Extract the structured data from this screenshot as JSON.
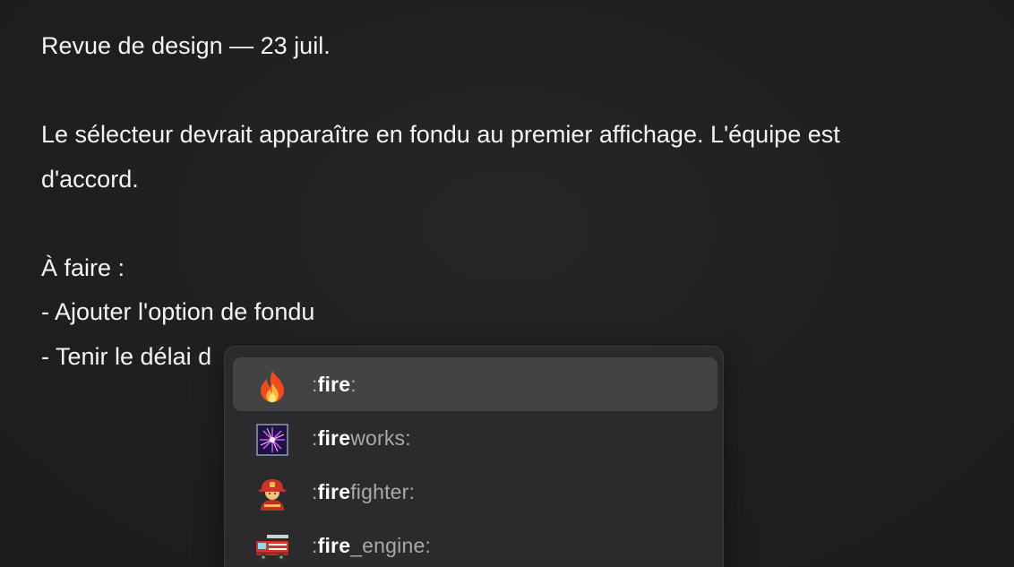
{
  "document": {
    "lines": [
      "Revue de design — 23 juil.",
      "",
      "Le sélecteur devrait apparaître en fondu au premier affichage. L'équipe est",
      "d'accord.",
      "",
      "À faire :",
      "- Ajouter l'option de fondu",
      "- Tenir le délai d"
    ]
  },
  "emoji_picker": {
    "query": "fire",
    "items": [
      {
        "emoji": "🔥",
        "icon": "fire-icon",
        "prefix": ":",
        "match": "fire",
        "rest": "",
        "suffix": ":",
        "selected": true
      },
      {
        "emoji": "🎆",
        "icon": "fireworks-icon",
        "prefix": ":",
        "match": "fire",
        "rest": "works",
        "suffix": ":",
        "selected": false
      },
      {
        "emoji": "🧑‍🚒",
        "icon": "firefighter-icon",
        "prefix": ":",
        "match": "fire",
        "rest": "fighter",
        "suffix": ":",
        "selected": false
      },
      {
        "emoji": "🚒",
        "icon": "fire-engine-icon",
        "prefix": ":",
        "match": "fire",
        "rest": "_engine",
        "suffix": ":",
        "selected": false
      }
    ]
  },
  "colors": {
    "background": "#1f1f20",
    "picker_background": "#2b2b2d",
    "selected_row": "#434345",
    "text": "#f4f4f4",
    "muted_text": "#a9a9ab"
  }
}
